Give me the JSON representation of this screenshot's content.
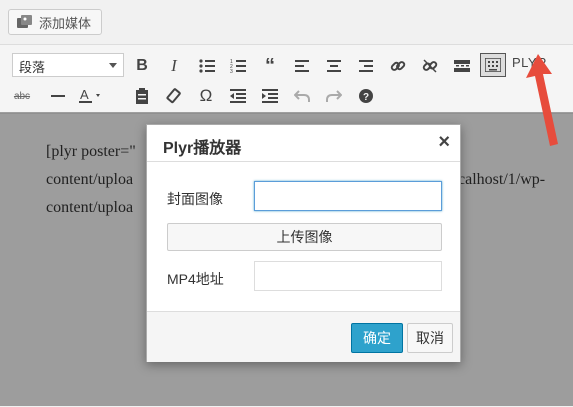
{
  "media_button": {
    "label": "添加媒体"
  },
  "toolbar": {
    "format_select": "段落",
    "plyr_label": "PLYR",
    "row1_icons": [
      "bold-icon",
      "italic-icon",
      "bullet-list-icon",
      "numbered-list-icon",
      "blockquote-icon",
      "align-left-icon",
      "align-center-icon",
      "align-right-icon",
      "link-icon",
      "unlink-icon",
      "read-more-icon",
      "toolbar-toggle-icon"
    ],
    "row2_icons": [
      "strikethrough-icon",
      "horizontal-line-icon",
      "text-color-icon",
      "paste-text-icon",
      "clear-formatting-icon",
      "special-character-icon",
      "outdent-icon",
      "indent-icon",
      "undo-icon",
      "redo-icon",
      "help-icon"
    ]
  },
  "content": {
    "lines": [
      "[plyr poster=\"",
      "content/uploa",
      "content/uploa"
    ],
    "right_fragment": "ocalhost/1/wp-"
  },
  "dialog": {
    "title": "Plyr播放器",
    "close": "×",
    "poster_label": "封面图像",
    "poster_value": "",
    "upload_label": "上传图像",
    "mp4_label": "MP4地址",
    "mp4_value": "",
    "ok_label": "确定",
    "cancel_label": "取消"
  },
  "colors": {
    "primary_button": "#2ea2cc",
    "annotation_arrow": "#e74c3c"
  }
}
